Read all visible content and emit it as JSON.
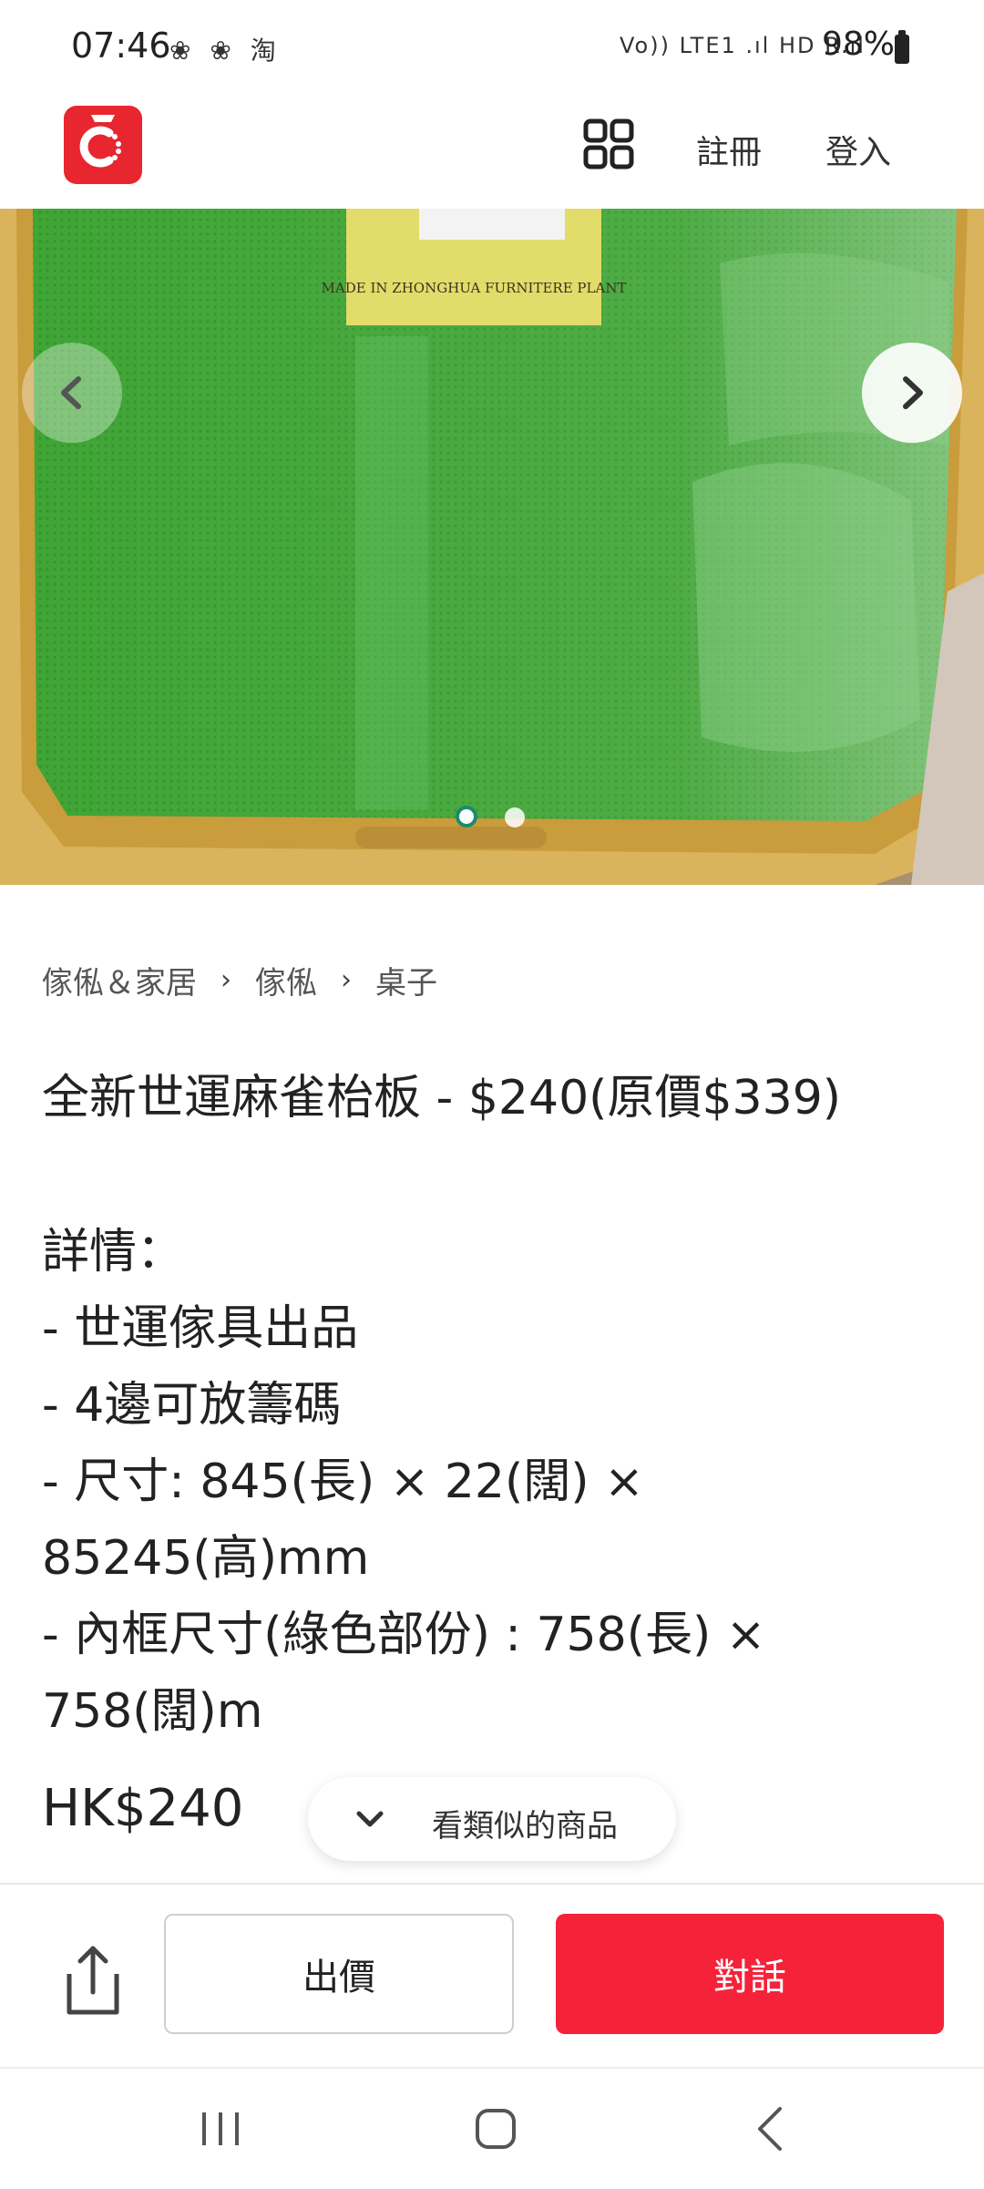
{
  "status_bar": {
    "time": "07:46",
    "app_icons": "❀ ❀ 淘",
    "network": "Vo)) LTE1 .ıl HD R.ıl",
    "battery": "98%"
  },
  "header": {
    "logo_icon": "carousell-logo-icon",
    "menu_icon": "grid-icon",
    "register_label": "註冊",
    "login_label": "登入",
    "brand_color": "#e8262f"
  },
  "carousel": {
    "image_content": "green mahjong board photo",
    "prev_icon": "chevron-left-icon",
    "next_icon": "chevron-right-icon",
    "current_page": 1,
    "page_count": 2,
    "image_plaque_text": "MADE IN ZHONGHUA FURNITERE PLANT"
  },
  "breadcrumb": {
    "items": [
      "傢俬＆家居",
      "傢俬",
      "桌子"
    ]
  },
  "listing": {
    "title": "全新世運麻雀枱板 - $240(原價$339)",
    "description_lines": [
      "詳情：",
      "- 世運傢具出品",
      "- 4邊可放籌碼",
      "- 尺寸: 845(長) × 22(闊) ×",
      "85245(高)mm",
      "- 內框尺寸(綠色部份) : 758(長) ×",
      "758(闊)m"
    ],
    "price": "HK$240"
  },
  "similar": {
    "label": "看類似的商品",
    "icon": "chevron-down-icon"
  },
  "actions": {
    "share_icon": "share-icon",
    "offer_label": "出價",
    "chat_label": "對話",
    "chat_color": "#f5223a"
  },
  "nav_bar": {
    "recents_icon": "recents-icon",
    "home_icon": "home-icon",
    "back_icon": "back-icon"
  }
}
